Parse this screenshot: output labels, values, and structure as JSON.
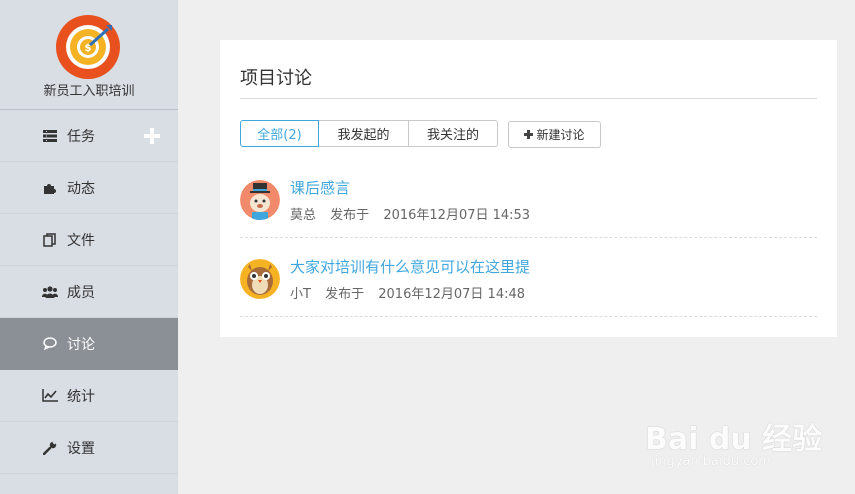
{
  "project": {
    "name": "新员工入职培训"
  },
  "nav": [
    {
      "label": "任务",
      "icon": "list-icon"
    },
    {
      "label": "动态",
      "icon": "puzzle-icon"
    },
    {
      "label": "文件",
      "icon": "files-icon"
    },
    {
      "label": "成员",
      "icon": "users-icon"
    },
    {
      "label": "讨论",
      "icon": "chat-icon",
      "active": true
    },
    {
      "label": "统计",
      "icon": "chart-icon"
    },
    {
      "label": "设置",
      "icon": "wrench-icon"
    }
  ],
  "card": {
    "title": "项目讨论",
    "tabs": [
      "全部(2)",
      "我发起的",
      "我关注的"
    ],
    "new_button": "新建讨论"
  },
  "topics": [
    {
      "title": "课后感言",
      "author": "莫总",
      "action": "发布于",
      "time": "2016年12月07日 14:53"
    },
    {
      "title": "大家对培训有什么意见可以在这里提",
      "author": "小T",
      "action": "发布于",
      "time": "2016年12月07日 14:48"
    }
  ],
  "watermark": {
    "brand": "Bai du 经验",
    "url": "jingyan.baidu.com"
  },
  "colors": {
    "accent": "#3fa7de",
    "sidebar": "#d9dde4",
    "active": "#8b8f96"
  }
}
